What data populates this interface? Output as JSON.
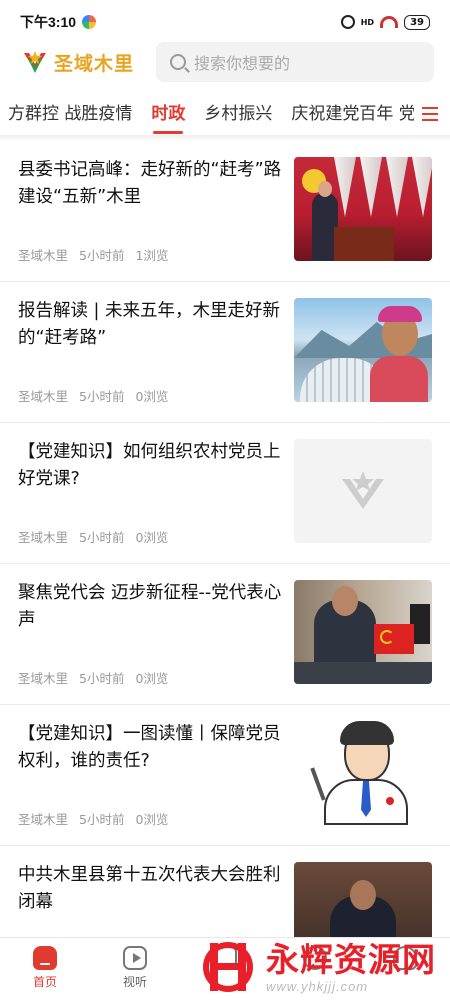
{
  "status_bar": {
    "time": "下午3:10",
    "hd_label": "HD",
    "battery": "39"
  },
  "header": {
    "app_name": "圣域木里",
    "brand_color": "#e8a420",
    "search": {
      "placeholder": "搜索你想要的"
    }
  },
  "tabs": {
    "items": [
      {
        "label": "方群控 战胜疫情"
      },
      {
        "label": "时政"
      },
      {
        "label": "乡村振兴"
      },
      {
        "label": "庆祝建党百年 党"
      }
    ],
    "active_index": 1,
    "accent_color": "#e13b2f",
    "menu_icon": "menu-icon"
  },
  "news": [
    {
      "title": "县委书记高峰：走好新的“赶考”路 建设“五新”木里",
      "source": "圣域木里",
      "time": "5小时前",
      "views": "1浏览",
      "thumb": "meeting-speech"
    },
    {
      "title": "报告解读 | 未来五年，木里走好新的“赶考路”",
      "source": "圣域木里",
      "time": "5小时前",
      "views": "0浏览",
      "thumb": "greenhouse-farmer"
    },
    {
      "title": "【党建知识】如何组织农村党员上好党课?",
      "source": "圣域木里",
      "time": "5小时前",
      "views": "0浏览",
      "thumb": "placeholder-logo"
    },
    {
      "title": "聚焦党代会 迈步新征程--党代表心声",
      "source": "圣域木里",
      "time": "5小时前",
      "views": "0浏览",
      "thumb": "delegate-portrait"
    },
    {
      "title": "【党建知识】一图读懂丨保障党员权利，谁的责任?",
      "source": "圣域木里",
      "time": "5小时前",
      "views": "0浏览",
      "thumb": "cartoon-official"
    },
    {
      "title": "中共木里县第十五次代表大会胜利闭幕",
      "source": "",
      "time": "",
      "views": "",
      "thumb": "congress-speaker"
    }
  ],
  "bottom_nav": [
    {
      "label": "首页",
      "icon": "home-icon",
      "active": true
    },
    {
      "label": "视听",
      "icon": "play-icon",
      "active": false
    },
    {
      "label": "",
      "icon": "box-icon",
      "active": false
    },
    {
      "label": "",
      "icon": "grid-icon",
      "active": false
    },
    {
      "label": "",
      "icon": "user-icon",
      "active": false
    }
  ],
  "watermark": {
    "title": "永辉资源网",
    "url": "www.yhkjjj.com",
    "color": "#e8202a"
  }
}
